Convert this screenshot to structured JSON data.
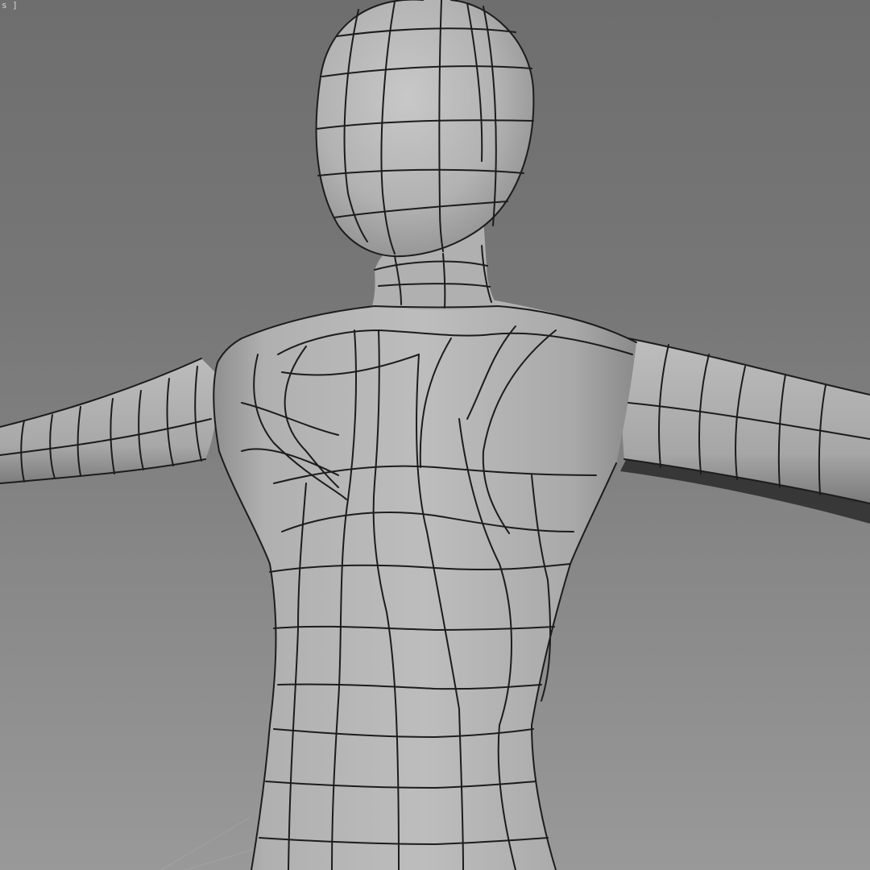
{
  "viewport": {
    "label": "s ]",
    "colors": {
      "background_top": "#6e6e6e",
      "background_bottom": "#999999",
      "mesh_fill": "#b4b4b4",
      "wireframe": "#1a1a1a"
    }
  },
  "scene": {
    "object_type": "humanoid-base-mesh",
    "shading_mode": "shaded-with-edged-faces",
    "pose": "t-pose"
  }
}
